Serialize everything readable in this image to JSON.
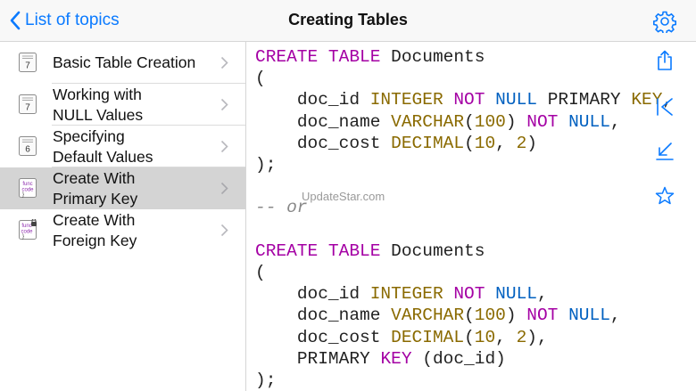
{
  "nav": {
    "back_label": "List of topics",
    "title": "Creating Tables"
  },
  "sidebar": {
    "items": [
      {
        "line1": "Basic Table Creation",
        "line2": "",
        "icon": "page-7-icon",
        "badge": "7"
      },
      {
        "line1": "Working with",
        "line2": "NULL Values",
        "icon": "page-7-icon",
        "badge": "7"
      },
      {
        "line1": "Specifying",
        "line2": "Default Values",
        "icon": "page-6-icon",
        "badge": "6"
      },
      {
        "line1": "Create With",
        "line2": "Primary Key",
        "icon": "func-code-icon",
        "selected": true
      },
      {
        "line1": "Create With",
        "line2": "Foreign Key",
        "icon": "func-code-locked-icon"
      }
    ]
  },
  "code": {
    "create_kw": "CREATE",
    "table_kw": "TABLE",
    "table_name": "Documents",
    "open_paren": "(",
    "close": ");",
    "or_comment": "-- or",
    "cols": {
      "id": "doc_id",
      "name": "doc_name",
      "cost": "doc_cost"
    },
    "types": {
      "integer": "INTEGER",
      "varchar": "VARCHAR",
      "decimal": "DECIMAL"
    },
    "kw": {
      "not": "NOT",
      "null": "NULL",
      "primary": "PRIMARY",
      "key": "KEY"
    },
    "nums": {
      "n100": "100",
      "n10": "10",
      "n2": "2"
    }
  },
  "watermark": "UpdateStar.com",
  "toolbar": {
    "icons": [
      "gear-icon",
      "share-icon",
      "first-page-icon",
      "collapse-icon",
      "favorite-star-icon"
    ]
  },
  "colors": {
    "accent": "#0a7aff",
    "keyword": "#a400a4",
    "type": "#8a6a00",
    "null_literal": "#0060c0",
    "selected_row": "#d4d4d4"
  }
}
